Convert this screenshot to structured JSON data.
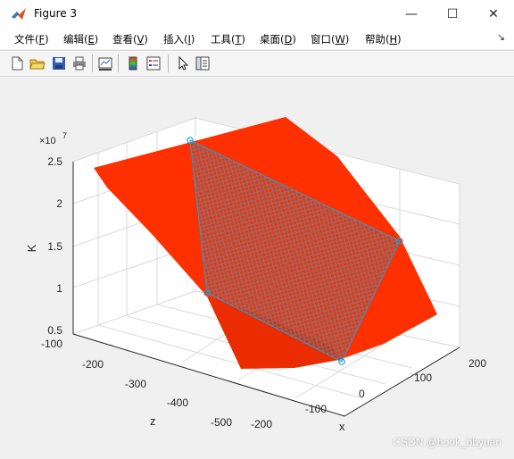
{
  "window": {
    "title": "Figure 3",
    "minimize": "—",
    "maximize": "☐",
    "close": "✕"
  },
  "menu": [
    {
      "label": "文件(",
      "hotkey": "F",
      "end": ")"
    },
    {
      "label": "编辑(",
      "hotkey": "E",
      "end": ")"
    },
    {
      "label": "查看(",
      "hotkey": "V",
      "end": ")"
    },
    {
      "label": "插入(",
      "hotkey": "I",
      "end": ")"
    },
    {
      "label": "工具(",
      "hotkey": "T",
      "end": ")"
    },
    {
      "label": "桌面(",
      "hotkey": "D",
      "end": ")"
    },
    {
      "label": "窗口(",
      "hotkey": "W",
      "end": ")"
    },
    {
      "label": "帮助(",
      "hotkey": "H",
      "end": ")"
    }
  ],
  "menu_pin": "↘",
  "toolbar_icons": [
    "new-figure-icon",
    "open-file-icon",
    "save-icon",
    "print-icon",
    "link-plot-icon",
    "colorbar-icon",
    "legend-icon",
    "pointer-icon",
    "property-inspector-icon"
  ],
  "plot": {
    "zlabel": "K",
    "xlabel": "x",
    "ylabel": "z",
    "exponent_prefix": "×10",
    "exponent": "7",
    "k_ticks": [
      "2.5",
      "2",
      "1.5",
      "1",
      "0.5"
    ],
    "x_ticks": [
      "-200",
      "-100",
      "0",
      "100",
      "200"
    ],
    "z_ticks": [
      "-100",
      "-200",
      "-300",
      "-400",
      "-500"
    ]
  },
  "watermark": "CSDN @book_bbyuan",
  "colors": {
    "marker": "#1f9fd6",
    "background": "#f0f0f0",
    "axes_face": "#ffffff"
  }
}
